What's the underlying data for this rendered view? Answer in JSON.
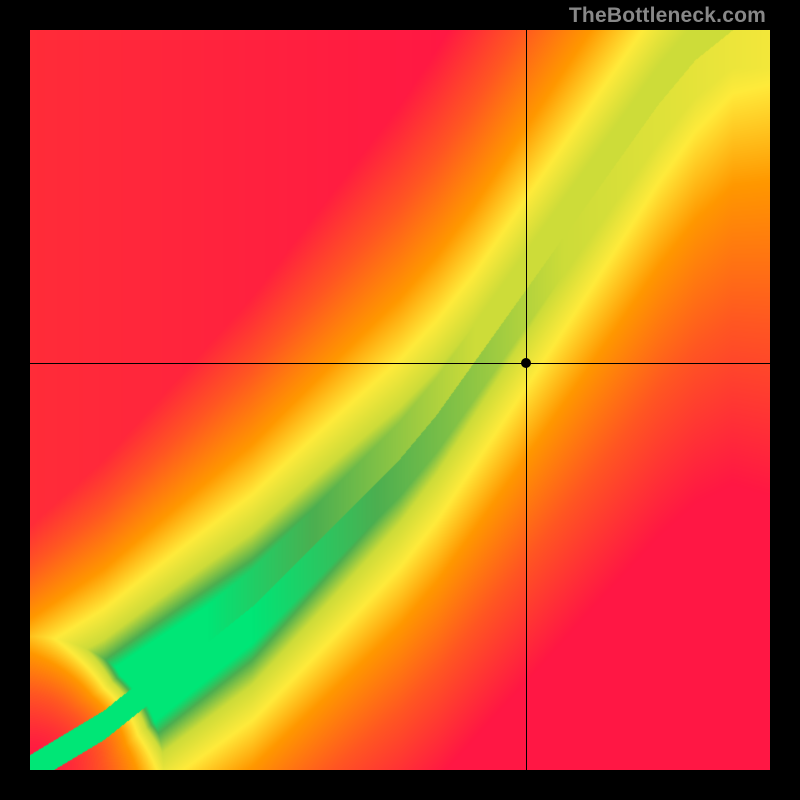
{
  "watermark": "TheBottleneck.com",
  "chart_data": {
    "type": "heatmap",
    "title": "",
    "xlabel": "",
    "ylabel": "",
    "xlim": [
      0,
      100
    ],
    "ylim": [
      0,
      100
    ],
    "grid": false,
    "legend": false,
    "crosshair": {
      "x": 67.0,
      "y": 55.0
    },
    "point": {
      "x": 67.0,
      "y": 55.0
    },
    "ridge": {
      "description": "Optimal (green) band as y(x); heat decays from this ridge through yellow/orange/red",
      "samples": [
        {
          "x": 0,
          "y": 0
        },
        {
          "x": 5,
          "y": 3
        },
        {
          "x": 10,
          "y": 6
        },
        {
          "x": 15,
          "y": 10
        },
        {
          "x": 20,
          "y": 14
        },
        {
          "x": 25,
          "y": 18
        },
        {
          "x": 30,
          "y": 22
        },
        {
          "x": 35,
          "y": 27
        },
        {
          "x": 40,
          "y": 32
        },
        {
          "x": 45,
          "y": 37
        },
        {
          "x": 50,
          "y": 42
        },
        {
          "x": 55,
          "y": 48
        },
        {
          "x": 60,
          "y": 55
        },
        {
          "x": 65,
          "y": 62
        },
        {
          "x": 70,
          "y": 69
        },
        {
          "x": 75,
          "y": 76
        },
        {
          "x": 80,
          "y": 83
        },
        {
          "x": 85,
          "y": 90
        },
        {
          "x": 90,
          "y": 96
        },
        {
          "x": 95,
          "y": 100
        },
        {
          "x": 100,
          "y": 100
        }
      ],
      "band_half_width_percent": 5.0
    },
    "color_scale": [
      {
        "stop": 0.0,
        "color": "#ff1744"
      },
      {
        "stop": 0.3,
        "color": "#ff5722"
      },
      {
        "stop": 0.55,
        "color": "#ff9800"
      },
      {
        "stop": 0.72,
        "color": "#ffeb3b"
      },
      {
        "stop": 0.85,
        "color": "#cddc39"
      },
      {
        "stop": 0.94,
        "color": "#4caf50"
      },
      {
        "stop": 1.0,
        "color": "#00e676"
      }
    ]
  }
}
